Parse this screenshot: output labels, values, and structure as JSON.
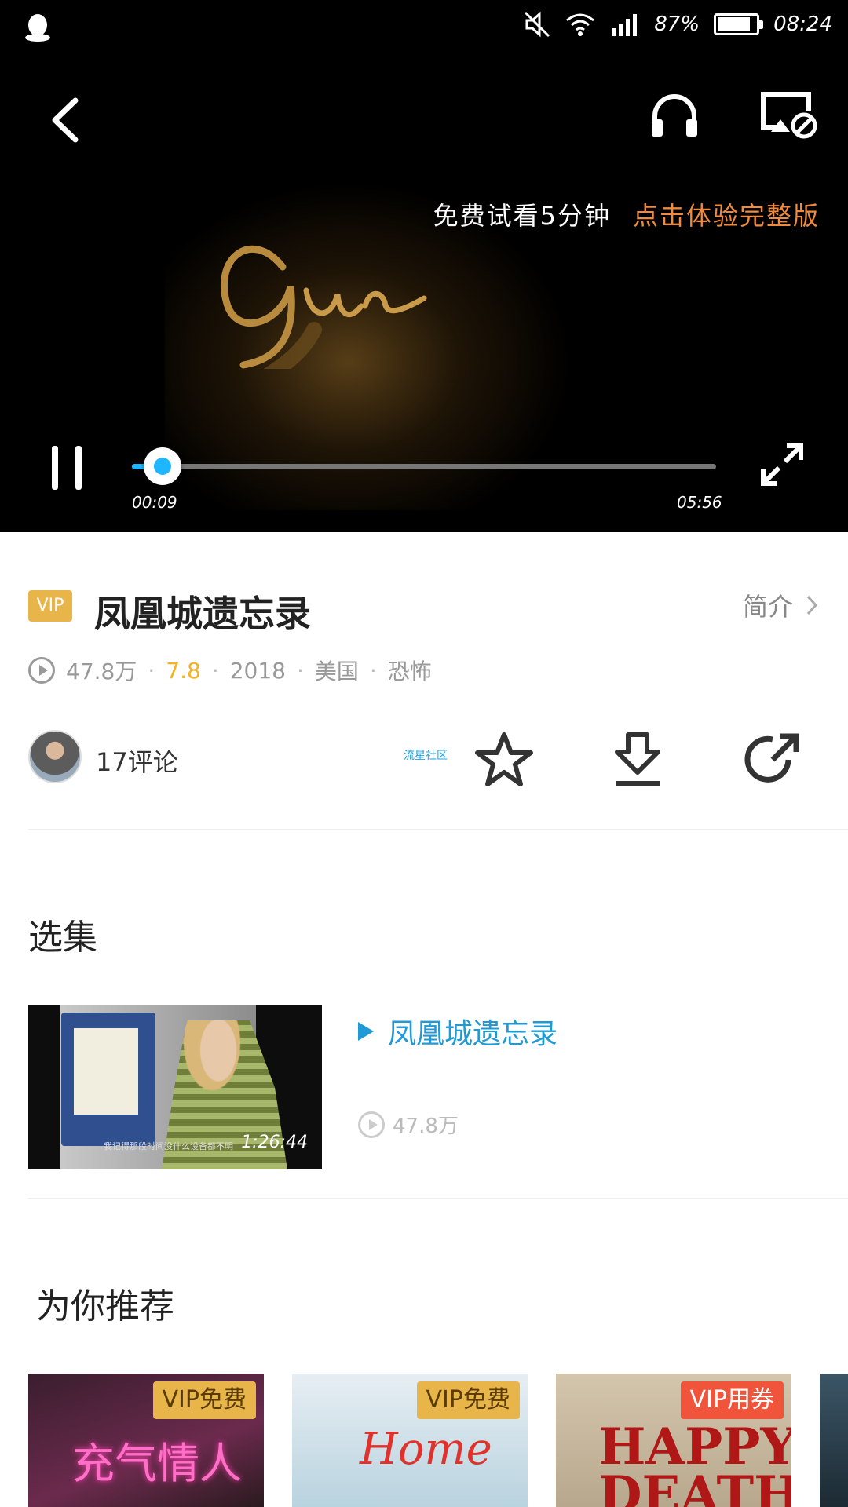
{
  "status_bar": {
    "battery": "87%",
    "time": "08:24",
    "battery_level": 0.87
  },
  "player": {
    "trial_text": "免费试看5分钟",
    "trial_cta": "点击体验完整版",
    "current_time": "00:09",
    "duration": "05:56",
    "progress": 0.025,
    "colors": {
      "accent": "#1fb5ff",
      "cta": "#f08a3c"
    }
  },
  "info": {
    "vip_badge": "VIP",
    "title": "凤凰城遗忘录",
    "intro_label": "简介",
    "views": "47.8万",
    "score": "7.8",
    "year": "2018",
    "region": "美国",
    "genre": "恐怖",
    "comments": "17评论",
    "community": "流星社区"
  },
  "episodes": {
    "section_title": "选集",
    "items": [
      {
        "title": "凤凰城遗忘录",
        "views": "47.8万",
        "duration": "1:26:44",
        "subtitle": "我记得那段时间没什么设备都不明"
      }
    ]
  },
  "recommend": {
    "section_title": "为你推荐",
    "items": [
      {
        "badge": "VIP免费",
        "poster_text": "充气情人"
      },
      {
        "badge": "VIP免费",
        "poster_text": "Home"
      },
      {
        "badge": "VIP用券",
        "poster_text": "HAPPY DEATH"
      }
    ]
  }
}
